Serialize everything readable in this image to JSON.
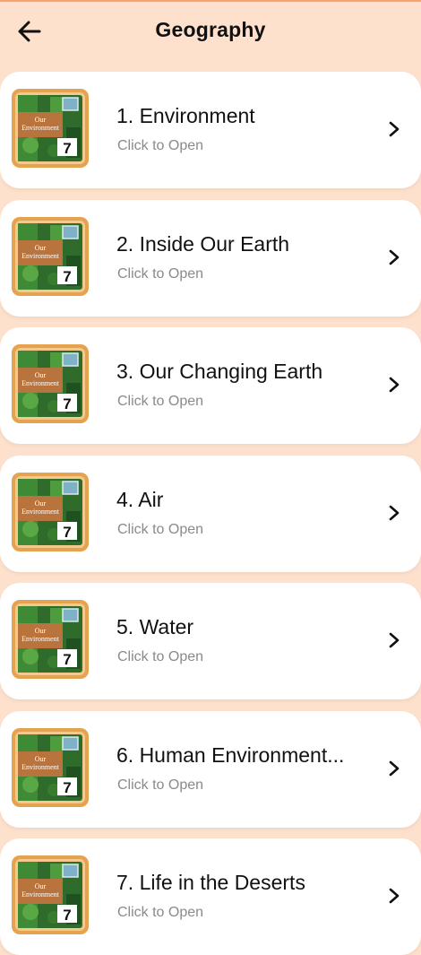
{
  "header": {
    "title": "Geography",
    "back_icon": "arrow-left-icon"
  },
  "thumbnail": {
    "line1": "Our",
    "line2": "Environment",
    "grade": "7"
  },
  "colors": {
    "background": "#fde1cd",
    "card": "#ffffff",
    "thumb_frame": "#e5a24f",
    "thumb_banner": "#b9743e"
  },
  "chapters": [
    {
      "title": "1. Environment",
      "subtitle": "Click to Open"
    },
    {
      "title": "2. Inside Our Earth",
      "subtitle": "Click to Open"
    },
    {
      "title": "3. Our Changing Earth",
      "subtitle": "Click to Open"
    },
    {
      "title": "4. Air",
      "subtitle": "Click to Open"
    },
    {
      "title": "5. Water",
      "subtitle": "Click to Open"
    },
    {
      "title": "6. Human Environment...",
      "subtitle": "Click to Open"
    },
    {
      "title": "7. Life in the Deserts",
      "subtitle": "Click to Open"
    }
  ]
}
